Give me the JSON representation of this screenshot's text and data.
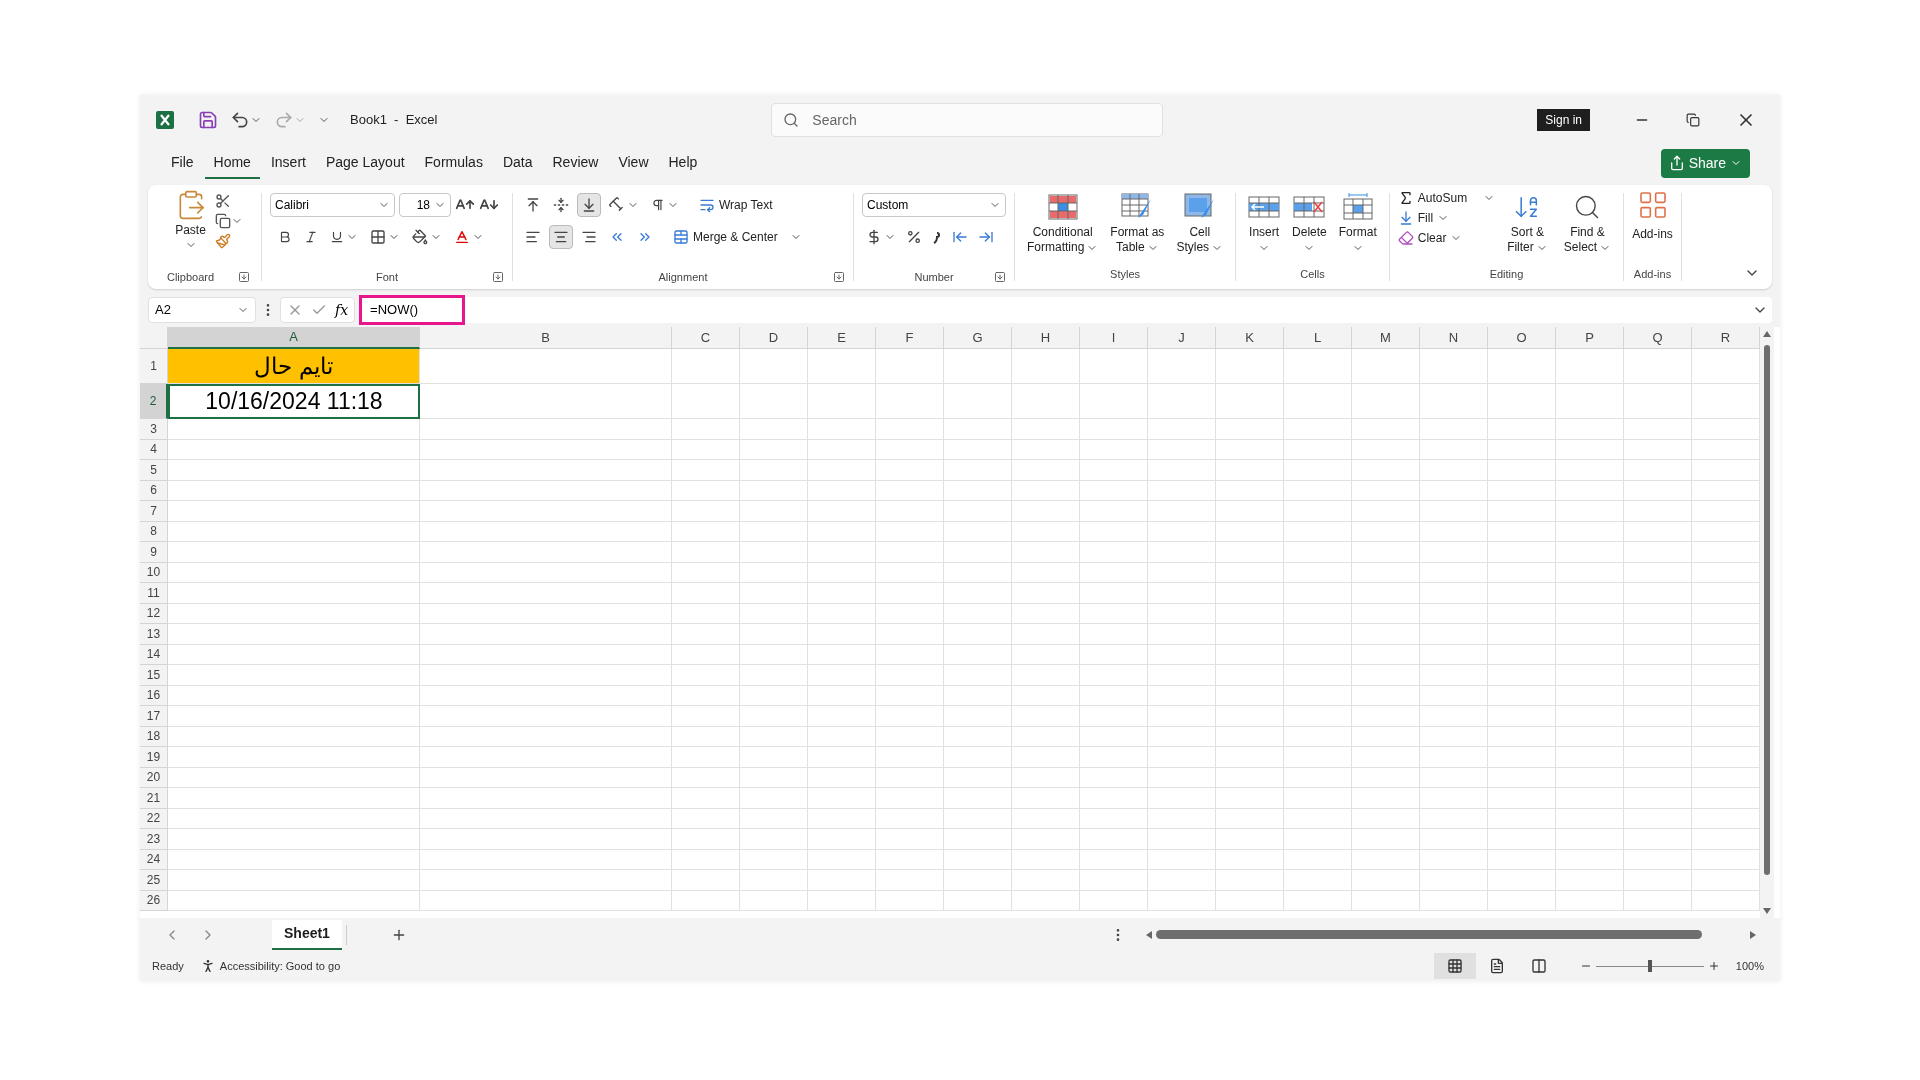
{
  "title_bar": {
    "document": "Book1  -  Excel",
    "search": {
      "placeholder": "Search"
    },
    "sign_in": "Sign in"
  },
  "menu_tabs": [
    {
      "label": "File",
      "selected": false
    },
    {
      "label": "Home",
      "selected": true
    },
    {
      "label": "Insert",
      "selected": false
    },
    {
      "label": "Page Layout",
      "selected": false
    },
    {
      "label": "Formulas",
      "selected": false
    },
    {
      "label": "Data",
      "selected": false
    },
    {
      "label": "Review",
      "selected": false
    },
    {
      "label": "View",
      "selected": false
    },
    {
      "label": "Help",
      "selected": false
    }
  ],
  "share": "Share",
  "ribbon": {
    "clipboard": {
      "label": "Clipboard",
      "paste": "Paste"
    },
    "font": {
      "label": "Font",
      "font_name": "Calibri",
      "font_size": "18"
    },
    "alignment": {
      "label": "Alignment",
      "wrap_text": "Wrap Text",
      "merge": "Merge & Center",
      "vertical": [
        {
          "kind": "top",
          "selected": false
        },
        {
          "kind": "middle",
          "selected": false
        },
        {
          "kind": "bottom",
          "selected": true
        }
      ],
      "horizontal": [
        {
          "kind": "left",
          "selected": false
        },
        {
          "kind": "center",
          "selected": true
        },
        {
          "kind": "right",
          "selected": false
        }
      ]
    },
    "number": {
      "label": "Number",
      "format": "Custom"
    },
    "styles": {
      "label": "Styles",
      "buttons": [
        {
          "kind": "conditional",
          "lines": [
            "Conditional",
            "Formatting"
          ]
        },
        {
          "kind": "table",
          "lines": [
            "Format as",
            "Table"
          ]
        },
        {
          "kind": "cell-styles",
          "lines": [
            "Cell",
            "Styles"
          ]
        }
      ]
    },
    "cells": {
      "label": "Cells",
      "buttons": [
        {
          "kind": "insert",
          "lines": [
            "Insert"
          ]
        },
        {
          "kind": "delete",
          "lines": [
            "Delete"
          ]
        },
        {
          "kind": "format",
          "lines": [
            "Format"
          ]
        }
      ]
    },
    "editing": {
      "label": "Editing",
      "autosum": "AutoSum",
      "fill": "Fill",
      "clear": "Clear",
      "buttons": [
        {
          "kind": "sort",
          "lines": [
            "Sort &",
            "Filter"
          ]
        },
        {
          "kind": "find",
          "lines": [
            "Find &",
            "Select"
          ]
        }
      ]
    },
    "addins": {
      "label": "Add-ins",
      "button": "Add-ins"
    }
  },
  "formula_bar": {
    "name_box": "A2",
    "function_label": "fx",
    "formula": "=NOW()",
    "highlighted": true
  },
  "sheet": {
    "columns": [
      {
        "label": "A",
        "selected": true
      },
      {
        "label": "B",
        "selected": false
      },
      {
        "label": "C",
        "selected": false
      },
      {
        "label": "D",
        "selected": false
      },
      {
        "label": "E",
        "selected": false
      },
      {
        "label": "F",
        "selected": false
      },
      {
        "label": "G",
        "selected": false
      },
      {
        "label": "H",
        "selected": false
      },
      {
        "label": "I",
        "selected": false
      },
      {
        "label": "J",
        "selected": false
      },
      {
        "label": "K",
        "selected": false
      },
      {
        "label": "L",
        "selected": false
      },
      {
        "label": "M",
        "selected": false
      },
      {
        "label": "N",
        "selected": false
      },
      {
        "label": "O",
        "selected": false
      },
      {
        "label": "P",
        "selected": false
      },
      {
        "label": "Q",
        "selected": false
      },
      {
        "label": "R",
        "selected": false
      }
    ],
    "rows": [
      {
        "label": "1",
        "selected": false,
        "cells": [
          {
            "text": "تایم حال",
            "color": "#ffc000",
            "selected": false
          }
        ]
      },
      {
        "label": "2",
        "selected": true,
        "cells": [
          {
            "text": "10/16/2024 11:18",
            "selected": true
          }
        ]
      },
      {
        "label": "3",
        "selected": false
      },
      {
        "label": "4",
        "selected": false
      },
      {
        "label": "5",
        "selected": false
      },
      {
        "label": "6",
        "selected": false
      },
      {
        "label": "7",
        "selected": false
      },
      {
        "label": "8",
        "selected": false
      },
      {
        "label": "9",
        "selected": false
      },
      {
        "label": "10",
        "selected": false
      },
      {
        "label": "11",
        "selected": false
      },
      {
        "label": "12",
        "selected": false
      },
      {
        "label": "13",
        "selected": false
      },
      {
        "label": "14",
        "selected": false
      },
      {
        "label": "15",
        "selected": false
      },
      {
        "label": "16",
        "selected": false
      },
      {
        "label": "17",
        "selected": false
      },
      {
        "label": "18",
        "selected": false
      },
      {
        "label": "19",
        "selected": false
      },
      {
        "label": "20",
        "selected": false
      },
      {
        "label": "21",
        "selected": false
      },
      {
        "label": "22",
        "selected": false
      },
      {
        "label": "23",
        "selected": false
      },
      {
        "label": "24",
        "selected": false
      },
      {
        "label": "25",
        "selected": false
      },
      {
        "label": "26",
        "selected": false
      }
    ]
  },
  "sheet_tabs": [
    {
      "label": "Sheet1",
      "selected": true
    }
  ],
  "status_bar": {
    "ready": "Ready",
    "accessibility": "Accessibility: Good to go",
    "views": [
      {
        "kind": "normal",
        "selected": true
      },
      {
        "kind": "page-layout",
        "selected": false
      },
      {
        "kind": "page-break",
        "selected": false
      }
    ],
    "zoom": {
      "level": 0.5,
      "reading": "100%"
    }
  }
}
